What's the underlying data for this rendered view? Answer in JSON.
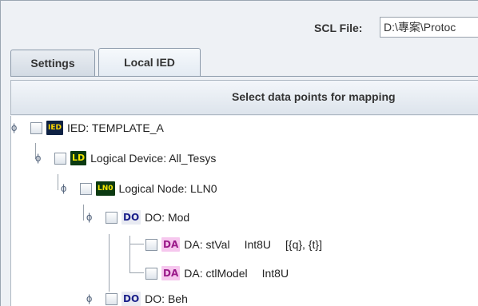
{
  "scl": {
    "label": "SCL File:",
    "path": "D:\\專案\\Protoc"
  },
  "tabs": [
    "Settings",
    "Local IED"
  ],
  "header": {
    "title": "Select data points for mapping"
  },
  "tree": {
    "handle_glyph": "ϕ",
    "nodes": [
      {
        "badge": "IED",
        "label": "IED: TEMPLATE_A"
      },
      {
        "badge": "LD",
        "label": "Logical Device: All_Tesys"
      },
      {
        "badge": "LN0",
        "label": "Logical Node: LLN0"
      },
      {
        "badge": "DO",
        "label": "DO: Mod"
      },
      {
        "badge": "DA",
        "label": "DA: stVal",
        "type": "Int8U",
        "trig": "[{q}, {t}]"
      },
      {
        "badge": "DA",
        "label": "DA: ctlModel",
        "type": "Int8U"
      },
      {
        "badge": "DO",
        "label": "DO: Beh"
      }
    ]
  }
}
